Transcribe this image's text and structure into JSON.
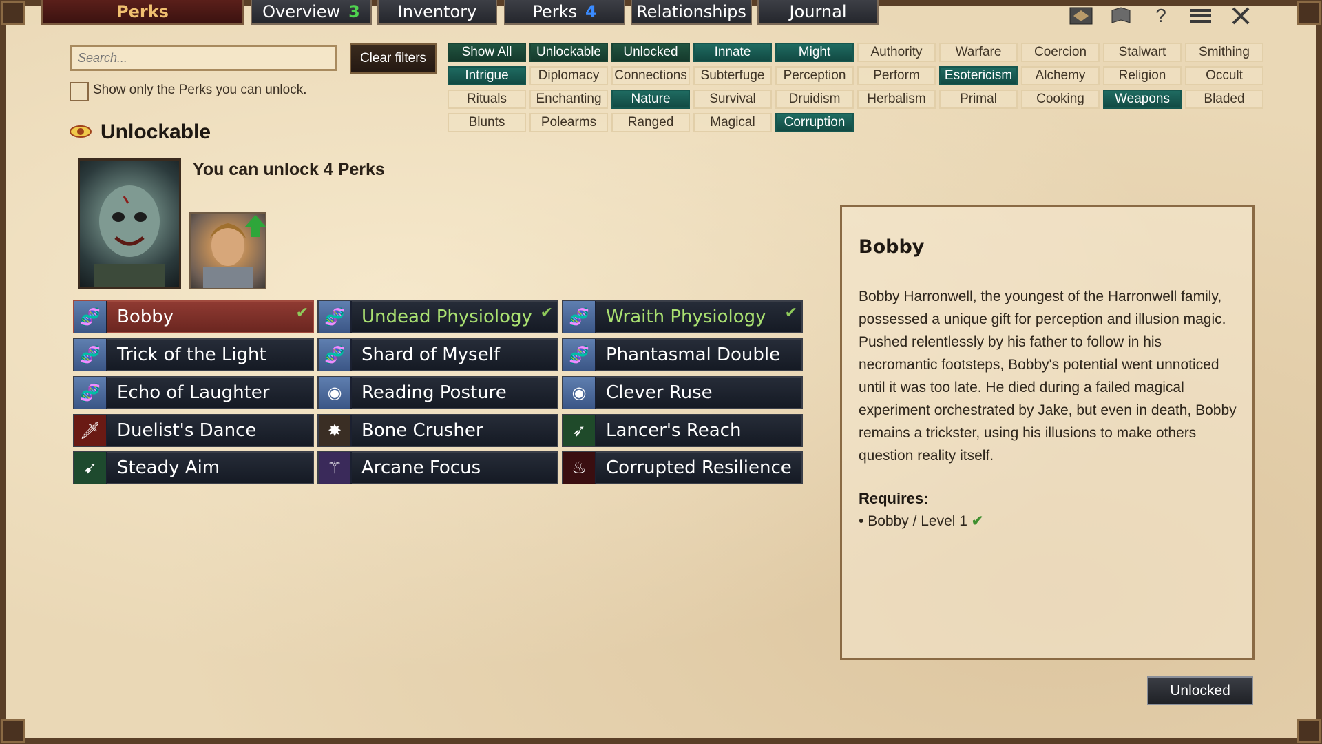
{
  "tabs": [
    {
      "label": "Perks",
      "badge": "",
      "active": true
    },
    {
      "label": "Overview",
      "badge": "3",
      "badge_color": "#4fd24f"
    },
    {
      "label": "Inventory",
      "badge": ""
    },
    {
      "label": "Perks",
      "badge": "4",
      "badge_color": "#3a8bff"
    },
    {
      "label": "Relationships",
      "badge": ""
    },
    {
      "label": "Journal",
      "badge": ""
    }
  ],
  "top_icons": [
    "map-icon",
    "scroll-icon",
    "help-icon",
    "menu-icon",
    "close-icon"
  ],
  "search": {
    "placeholder": "Search..."
  },
  "clear_filters_label": "Clear filters",
  "show_only_label": "Show only the Perks you can unlock.",
  "filters": [
    {
      "label": "Show All",
      "state": "dark"
    },
    {
      "label": "Unlockable",
      "state": "dark"
    },
    {
      "label": "Unlocked",
      "state": "dark"
    },
    {
      "label": "Innate",
      "state": "on"
    },
    {
      "label": "Might",
      "state": "on"
    },
    {
      "label": "Authority",
      "state": "off"
    },
    {
      "label": "Warfare",
      "state": "off"
    },
    {
      "label": "Coercion",
      "state": "off"
    },
    {
      "label": "Stalwart",
      "state": "off"
    },
    {
      "label": "Smithing",
      "state": "off"
    },
    {
      "label": "Intrigue",
      "state": "on"
    },
    {
      "label": "Diplomacy",
      "state": "off"
    },
    {
      "label": "Connections",
      "state": "off"
    },
    {
      "label": "Subterfuge",
      "state": "off"
    },
    {
      "label": "Perception",
      "state": "off"
    },
    {
      "label": "Perform",
      "state": "off"
    },
    {
      "label": "Esotericism",
      "state": "on"
    },
    {
      "label": "Alchemy",
      "state": "off"
    },
    {
      "label": "Religion",
      "state": "off"
    },
    {
      "label": "Occult",
      "state": "off"
    },
    {
      "label": "Rituals",
      "state": "off"
    },
    {
      "label": "Enchanting",
      "state": "off"
    },
    {
      "label": "Nature",
      "state": "on"
    },
    {
      "label": "Survival",
      "state": "off"
    },
    {
      "label": "Druidism",
      "state": "off"
    },
    {
      "label": "Herbalism",
      "state": "off"
    },
    {
      "label": "Primal",
      "state": "off"
    },
    {
      "label": "Cooking",
      "state": "off"
    },
    {
      "label": "Weapons",
      "state": "on"
    },
    {
      "label": "Bladed",
      "state": "off"
    },
    {
      "label": "Blunts",
      "state": "off"
    },
    {
      "label": "Polearms",
      "state": "off"
    },
    {
      "label": "Ranged",
      "state": "off"
    },
    {
      "label": "Magical",
      "state": "off"
    },
    {
      "label": "Corruption",
      "state": "on"
    }
  ],
  "section_title": "Unlockable",
  "unlock_text": "You can unlock 4 Perks",
  "perks": [
    {
      "name": "Bobby",
      "icon": "dna-icon",
      "selected": true,
      "checked": true
    },
    {
      "name": "Undead Physiology",
      "icon": "dna-icon",
      "green": true,
      "checked": true
    },
    {
      "name": "Wraith Physiology",
      "icon": "dna-icon",
      "green": true,
      "checked": true
    },
    {
      "name": "Trick of the Light",
      "icon": "dna-icon"
    },
    {
      "name": "Shard of Myself",
      "icon": "dna-icon"
    },
    {
      "name": "Phantasmal Double",
      "icon": "dna-icon"
    },
    {
      "name": "Echo of Laughter",
      "icon": "dna-icon"
    },
    {
      "name": "Reading Posture",
      "icon": "eye-icon"
    },
    {
      "name": "Clever Ruse",
      "icon": "eye-icon"
    },
    {
      "name": "Duelist's Dance",
      "icon": "sword-icon"
    },
    {
      "name": "Bone Crusher",
      "icon": "mace-icon"
    },
    {
      "name": "Lancer's Reach",
      "icon": "spear-icon"
    },
    {
      "name": "Steady Aim",
      "icon": "bow-icon"
    },
    {
      "name": "Arcane Focus",
      "icon": "staff-icon"
    },
    {
      "name": "Corrupted Resilience",
      "icon": "flame-icon"
    }
  ],
  "detail": {
    "title": "Bobby",
    "description": "Bobby Harronwell, the youngest of the Harronwell family, possessed a unique gift for perception and illusion magic. Pushed relentlessly by his father to follow in his necromantic footsteps, Bobby's potential went unnoticed until it was too late. He died during a failed magical experiment orchestrated by Jake, but even in death, Bobby remains a trickster, using his illusions to make others question reality itself.",
    "requires_label": "Requires:",
    "requirement": "Bobby / Level 1",
    "requirement_met": "✔"
  },
  "unlocked_button_label": "Unlocked",
  "colors": {
    "accent_active_filter": "#1f6b61",
    "perk_selected": "#8f3a32",
    "check_green": "#8ec95a"
  }
}
